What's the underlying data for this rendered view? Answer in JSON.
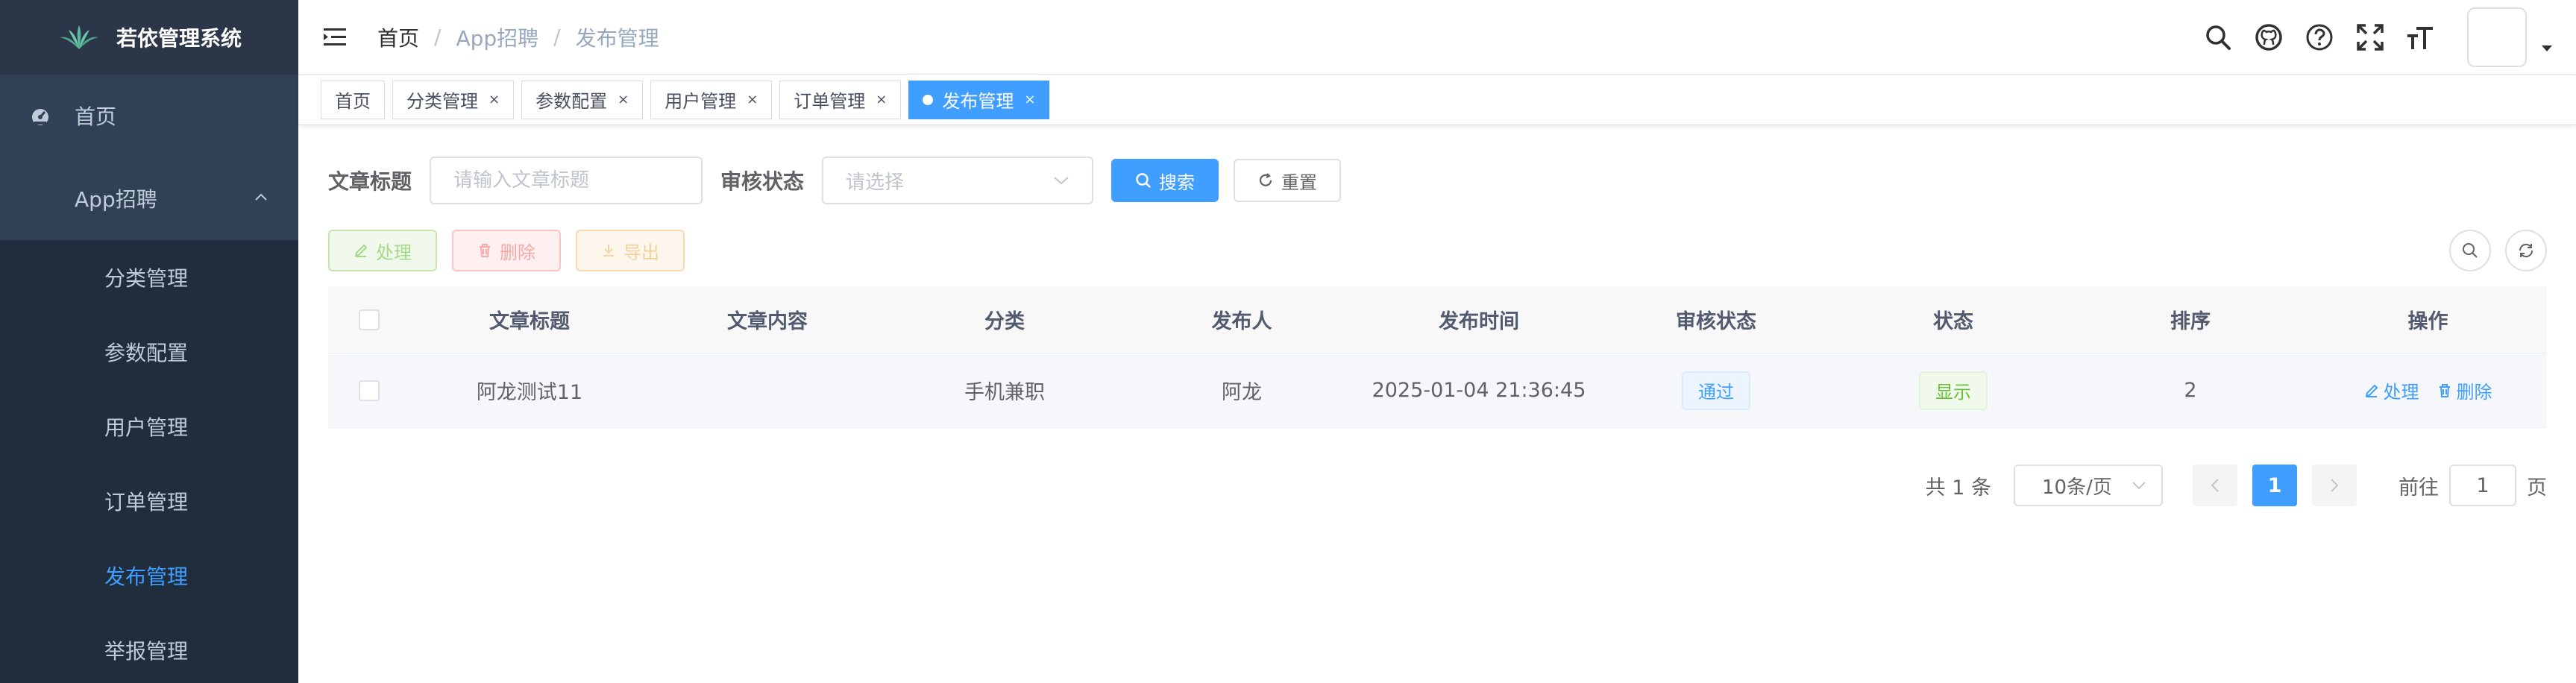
{
  "app": {
    "title": "若依管理系统"
  },
  "sidebar": {
    "home": "首页",
    "group": "App招聘",
    "items": [
      {
        "label": "分类管理"
      },
      {
        "label": "参数配置"
      },
      {
        "label": "用户管理"
      },
      {
        "label": "订单管理"
      },
      {
        "label": "发布管理",
        "active": true
      },
      {
        "label": "举报管理"
      }
    ]
  },
  "navbar": {
    "breadcrumb": [
      "首页",
      "App招聘",
      "发布管理"
    ],
    "icons": [
      "search-icon",
      "github-icon",
      "help-icon",
      "fullscreen-icon",
      "font-size-icon"
    ]
  },
  "tags": [
    {
      "label": "首页",
      "closable": false
    },
    {
      "label": "分类管理",
      "closable": true
    },
    {
      "label": "参数配置",
      "closable": true
    },
    {
      "label": "用户管理",
      "closable": true
    },
    {
      "label": "订单管理",
      "closable": true
    },
    {
      "label": "发布管理",
      "closable": true,
      "active": true
    }
  ],
  "search": {
    "title_label": "文章标题",
    "title_placeholder": "请输入文章标题",
    "status_label": "审核状态",
    "status_placeholder": "请选择",
    "search_btn": "搜索",
    "reset_btn": "重置"
  },
  "toolbar": {
    "process": "处理",
    "delete": "删除",
    "export": "导出"
  },
  "table": {
    "columns": [
      "文章标题",
      "文章内容",
      "分类",
      "发布人",
      "发布时间",
      "审核状态",
      "状态",
      "排序",
      "操作"
    ],
    "rows": [
      {
        "title": "阿龙测试11",
        "content": "",
        "category": "手机兼职",
        "publisher": "阿龙",
        "time": "2025-01-04 21:36:45",
        "audit": "通过",
        "status": "显示",
        "sort": "2",
        "op_process": "处理",
        "op_delete": "删除"
      }
    ]
  },
  "pagination": {
    "total": "共 1 条",
    "page_size": "10条/页",
    "current": "1",
    "goto_prefix": "前往",
    "goto_value": "1",
    "goto_suffix": "页"
  },
  "colors": {
    "primary": "#409eff",
    "sidebar_bg": "#304156",
    "submenu_bg": "#1f2d3d"
  }
}
